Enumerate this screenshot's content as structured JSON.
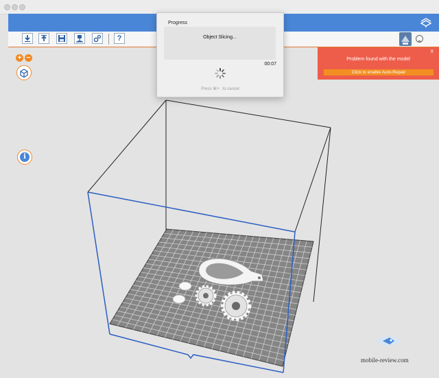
{
  "window": {
    "controls": [
      "close",
      "minimize",
      "zoom"
    ]
  },
  "colors": {
    "toolbar_accent": "#4a86d8",
    "orange_accent": "#f08a24",
    "alert_background": "#ee5d4a",
    "plate_fill": "#858585",
    "build_box_front": "#2a5ec2"
  },
  "toolbar": {
    "buttons": [
      "import-icon",
      "export-icon",
      "save-icon",
      "prepare-icon",
      "settings-icon",
      "help-icon"
    ],
    "help_glyph": "?"
  },
  "sidebar": {
    "zoom_in_glyph": "+",
    "zoom_out_glyph": "−",
    "view_icon": "cube-icon",
    "info_glyph": "i"
  },
  "progress_dialog": {
    "title": "Progress",
    "message": "Object Slicing...",
    "elapsed": "00:07",
    "hint": "Press ⌘+ . to cancel"
  },
  "alert": {
    "close_label": "X",
    "message": "Problem found with the model",
    "action_label": "Click to enable Auto-Repair"
  },
  "watermark": {
    "text": "mobile-review.com"
  }
}
